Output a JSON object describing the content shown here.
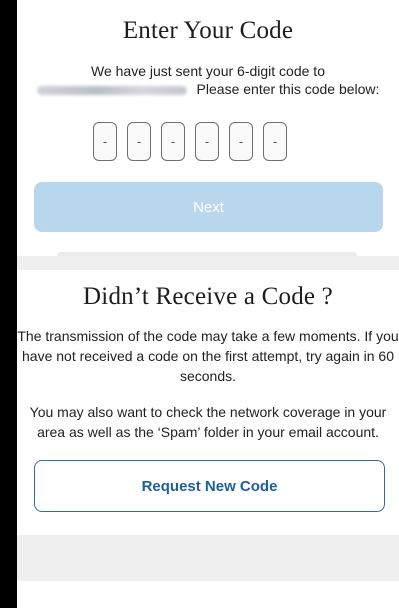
{
  "verify": {
    "title": "Enter Your Code",
    "line1": "We have just sent your 6-digit code to",
    "line2": "Please enter this code below:",
    "code_digits": [
      "-",
      "-",
      "-",
      "-",
      "-",
      "-"
    ],
    "next_label": "Next"
  },
  "help": {
    "title": "Didn’t Receive a Code ?",
    "para1": "The transmission of the code may take a few moments. If you have not received a code on the first attempt, try again in 60 seconds.",
    "para2": "You may also want to check the network coverage in your area as well as the ‘Spam’ folder in your email account.",
    "request_label": "Request New Code"
  },
  "colors": {
    "next_button_disabled": "#b9d7ec",
    "request_button_border": "#2b6ea6",
    "request_button_text": "#1f5f9a",
    "section_band": "#efefef"
  }
}
